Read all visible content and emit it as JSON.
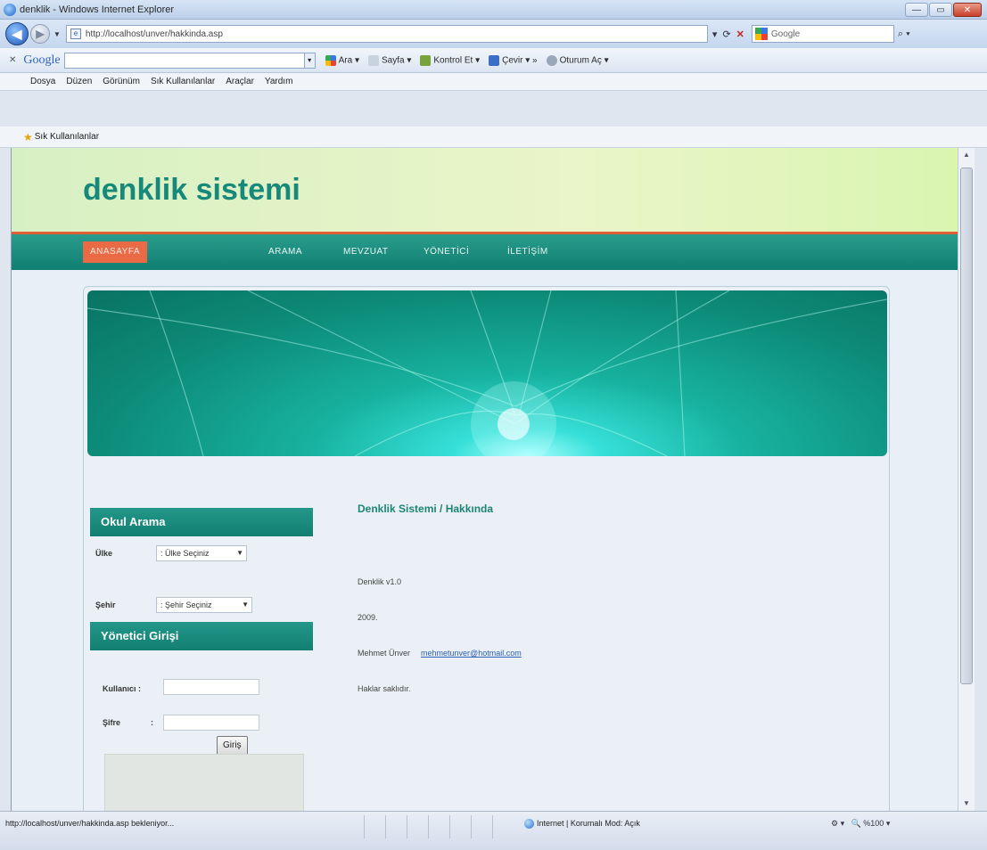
{
  "window": {
    "title": "denklik - Windows Internet Explorer",
    "buttons": {
      "minimize": "—",
      "maximize": "▭",
      "close": "✕"
    }
  },
  "address": {
    "url": "http://localhost/unver/hakkinda.asp",
    "search_placeholder": "Google"
  },
  "google_toolbar": {
    "logo": "Google",
    "items": [
      "Ara",
      "Sayfa",
      "Kontrol Et",
      "Çevir",
      "Oturum Aç"
    ]
  },
  "menu": {
    "items": [
      "Dosya",
      "Düzen",
      "Görünüm",
      "Sık Kullanılanlar",
      "Araçlar",
      "Yardım"
    ]
  },
  "favorites": {
    "label": "Sık Kullanılanlar"
  },
  "site": {
    "title": "denklik sistemi",
    "nav": [
      {
        "label": "ANASAYFA",
        "active": true
      },
      {
        "label": "ARAMA",
        "active": false
      },
      {
        "label": "MEVZUAT",
        "active": false
      },
      {
        "label": "YÖNETİCİ",
        "active": false
      },
      {
        "label": "İLETİŞİM",
        "active": false
      }
    ]
  },
  "sidebar": {
    "search_heading": "Okul Arama",
    "country_label": "Ülke",
    "country_value": ": Ülke Seçiniz",
    "city_label": "Şehir",
    "city_value": ": Şehir Seçiniz",
    "admin_heading": "Yönetici Girişi",
    "user_label": "Kullanıcı :",
    "password_label": "Şifre",
    "password_colon": ":",
    "login_button": "Giriş"
  },
  "main": {
    "title": "Denklik Sistemi / Hakkında",
    "version": "Denklik v1.0",
    "year": "2009.",
    "author": "Mehmet Ünver",
    "email": "mehmetunver@hotmail.com",
    "rights": "Haklar saklıdır."
  },
  "status": {
    "url": "http://localhost/unver/hakkinda.asp bekleniyor...",
    "zone": "Internet | Korumalı Mod: Açık",
    "zoom": "%100"
  },
  "colors": {
    "brand": "#17897a",
    "nav_active": "#ea6a45",
    "header_bg": "#d9f5b0"
  }
}
